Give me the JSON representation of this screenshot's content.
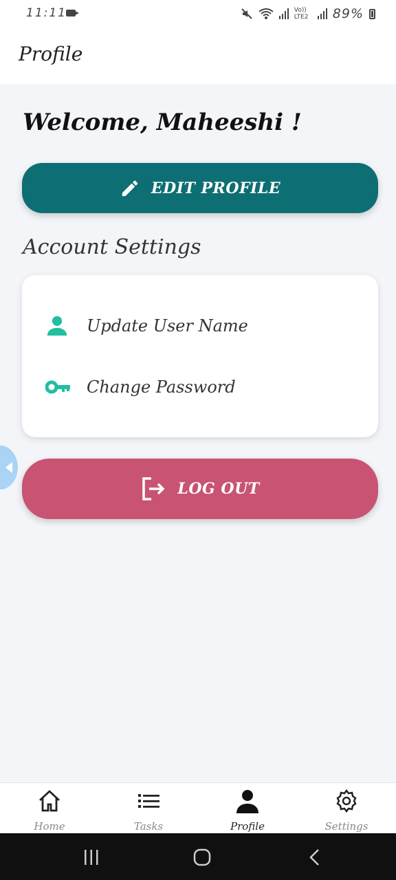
{
  "status_bar": {
    "time": "11:11",
    "battery": "89%",
    "network": "Vo)) LTE2"
  },
  "app_bar": {
    "title": "Profile"
  },
  "welcome": "Welcome, Maheeshi !",
  "edit_profile_label": "EDIT PROFILE",
  "account_settings": {
    "title": "Account Settings",
    "items": [
      {
        "label": "Update User Name",
        "icon": "user-icon"
      },
      {
        "label": "Change Password",
        "icon": "key-icon"
      }
    ]
  },
  "logout_label": "LOG OUT",
  "bottom_nav": [
    {
      "label": "Home",
      "icon": "home-icon",
      "active": false
    },
    {
      "label": "Tasks",
      "icon": "list-icon",
      "active": false
    },
    {
      "label": "Profile",
      "icon": "person-icon",
      "active": true
    },
    {
      "label": "Settings",
      "icon": "gear-icon",
      "active": false
    }
  ],
  "colors": {
    "primary": "#0d6e73",
    "logout": "#c85373",
    "accent_icon": "#1fbf9f",
    "background": "#f3f5f9"
  }
}
